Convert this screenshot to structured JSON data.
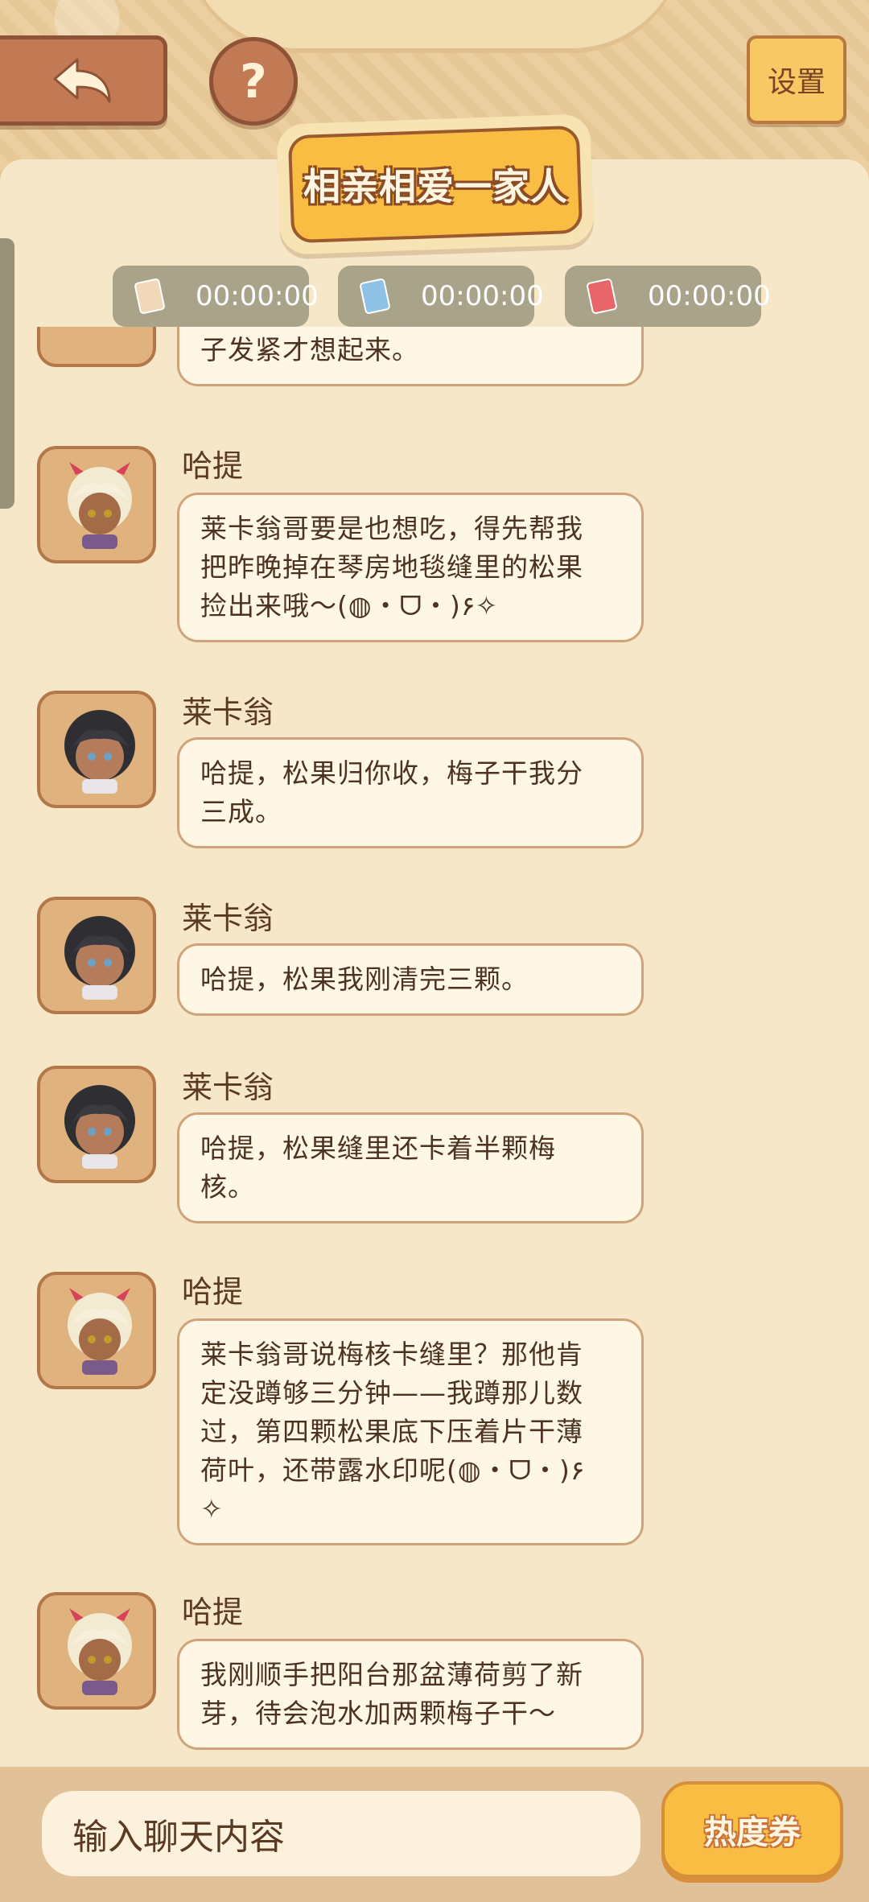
{
  "header": {
    "settings_label": "设置",
    "help_label": "?",
    "title": "相亲相爱一家人"
  },
  "timers": [
    {
      "icon": "card-icon",
      "color": "#f0d8b8",
      "time": "00:00:00"
    },
    {
      "icon": "card-icon",
      "color": "#8ec3e6",
      "time": "00:00:00"
    },
    {
      "icon": "card-icon",
      "color": "#e8666a",
      "time": "00:00:00"
    }
  ],
  "messages": [
    {
      "sender": "",
      "avatar": "partial-avatar",
      "lines": [
        "子发紧才想起来。"
      ]
    },
    {
      "sender": "哈提",
      "avatar": "hati-avatar",
      "lines": [
        "莱卡翁哥要是也想吃，得先帮我",
        "把昨晚掉在琴房地毯缝里的松果",
        "捡出来哦～(◍・ᗜ・)۶✧"
      ]
    },
    {
      "sender": "莱卡翁",
      "avatar": "lycaon-avatar",
      "lines": [
        "哈提，松果归你收，梅子干我分",
        "三成。"
      ]
    },
    {
      "sender": "莱卡翁",
      "avatar": "lycaon-avatar",
      "lines": [
        "哈提，松果我刚清完三颗。"
      ]
    },
    {
      "sender": "莱卡翁",
      "avatar": "lycaon-avatar",
      "lines": [
        "哈提，松果缝里还卡着半颗梅",
        "核。"
      ]
    },
    {
      "sender": "哈提",
      "avatar": "hati-avatar",
      "lines": [
        "莱卡翁哥说梅核卡缝里？那他肯",
        "定没蹲够三分钟——我蹲那儿数",
        "过，第四颗松果底下压着片干薄",
        "荷叶，还带露水印呢(◍・ᗜ・)۶",
        "✧"
      ]
    },
    {
      "sender": "哈提",
      "avatar": "hati-avatar",
      "lines": [
        "我刚顺手把阳台那盆薄荷剪了新",
        "芽，待会泡水加两颗梅子干～"
      ]
    }
  ],
  "input": {
    "placeholder": "输入聊天内容"
  },
  "heat_button_label": "热度券",
  "colors": {
    "accent": "#f9bd43",
    "brown": "#c27a55",
    "panel": "#f6e7c8"
  }
}
